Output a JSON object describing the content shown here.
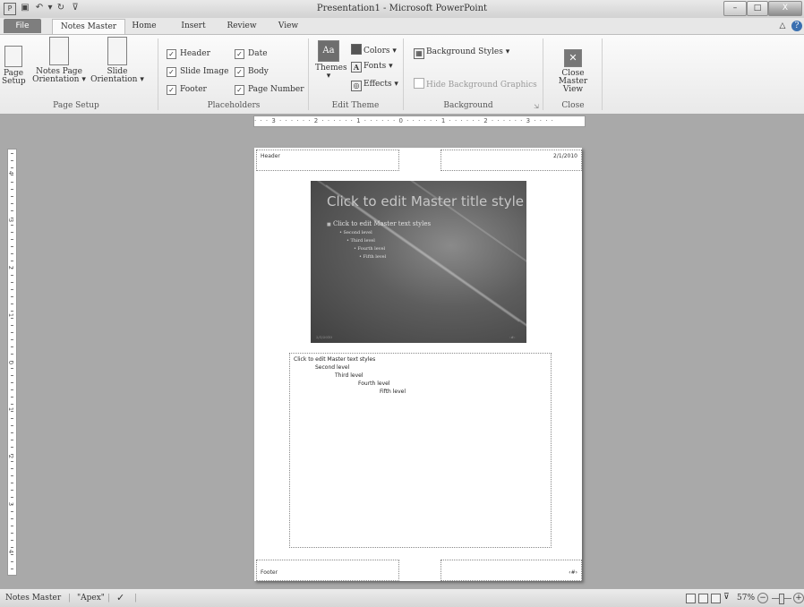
{
  "window": {
    "title": "Presentation1  -  Microsoft PowerPoint",
    "qat_icons": [
      "app-icon",
      "save-icon",
      "undo-icon",
      "redo-icon",
      "customize-icon"
    ],
    "controls": {
      "minimize": "–",
      "maximize": "□",
      "close": "X"
    }
  },
  "tabs": [
    {
      "label": "File"
    },
    {
      "label": "Notes Master"
    },
    {
      "label": "Home"
    },
    {
      "label": "Insert"
    },
    {
      "label": "Review"
    },
    {
      "label": "View"
    }
  ],
  "ribbon": {
    "page_setup": {
      "label": "Page Setup",
      "page_setup_btn": [
        "Page",
        "Setup"
      ],
      "notes_orientation_btn": [
        "Notes Page",
        "Orientation ▾"
      ],
      "slide_orientation_btn": [
        "Slide",
        "Orientation ▾"
      ]
    },
    "placeholders": {
      "label": "Placeholders",
      "header": "Header",
      "date": "Date",
      "slide_image": "Slide Image",
      "body": "Body",
      "footer": "Footer",
      "page_number": "Page Number",
      "check": "✓"
    },
    "edit_theme": {
      "label": "Edit Theme",
      "themes": "Themes",
      "themes_arrow": "▾",
      "colors": "Colors ▾",
      "fonts": "Fonts ▾",
      "effects": "Effects ▾"
    },
    "background": {
      "label": "Background",
      "styles": "Background Styles ▾",
      "hide_graphics": "Hide Background Graphics"
    },
    "close": {
      "label": "Close",
      "close_btn": [
        "Close",
        "Master View"
      ]
    }
  },
  "ruler": {
    "horizontal": "·  ·  ·  3  ·  ·  ·  ·  ·  ·  2  ·  ·  ·  ·  ·  ·  1  ·  ·  ·  ·  ·  ·  0  ·  ·  ·  ·  ·  ·  1  ·  ·  ·  ·  ·  ·  2  ·  ·  ·  ·  ·  ·  3  ·  ·  ·  ·",
    "vertical": [
      "4",
      "3",
      "2",
      "1",
      "0",
      "1",
      "2",
      "3",
      "4"
    ]
  },
  "page": {
    "header": "Header",
    "date": "2/1/2010",
    "footer": "Footer",
    "page_number": "‹#›",
    "slide": {
      "title": "Click to edit Master title style",
      "levels": [
        "Click to edit Master text styles",
        "Second level",
        "Third level",
        "Fourth level",
        "Fifth level"
      ],
      "bullet": "■",
      "footer_date": "2/1/2010",
      "footer_num": "‹#›"
    },
    "notes": [
      "Click to edit Master text styles",
      "Second level",
      "Third level",
      "Fourth level",
      "Fifth level"
    ]
  },
  "statusbar": {
    "view": "Notes Master",
    "theme": "\"Apex\"",
    "zoom": "57%",
    "zoom_fraction": 0.5,
    "minus": "−",
    "plus": "+"
  }
}
